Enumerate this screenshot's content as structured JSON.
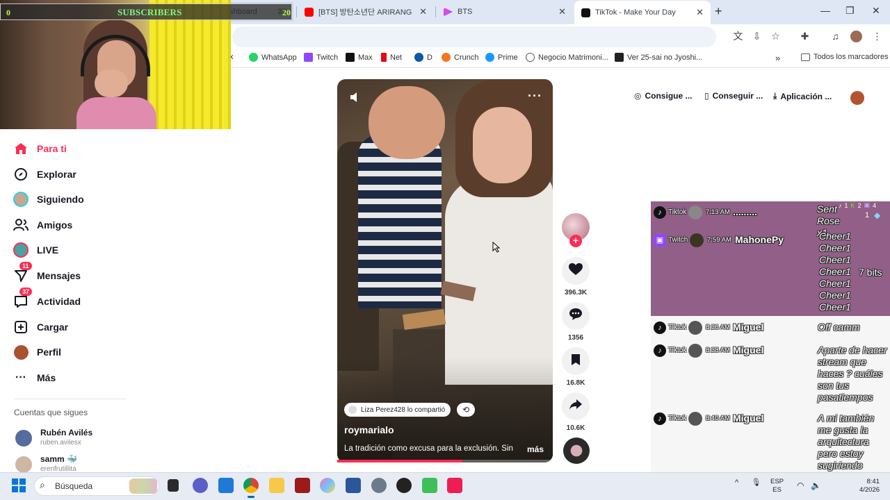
{
  "browser": {
    "tabs": [
      {
        "title": "shboard",
        "counter": "20"
      },
      {
        "title": "[BTS] 방탄소년단 ARIRANG [아",
        "color": "#ff0000"
      },
      {
        "title": "BTS",
        "color": "#ff3df0"
      },
      {
        "title": "TikTok - Make Your Day",
        "active": true
      }
    ],
    "new_tab": "+",
    "window_controls": [
      "minimize-icon",
      "maximize-icon",
      "close-icon"
    ],
    "bookmarks": [
      {
        "label": "x"
      },
      {
        "label": "WhatsApp",
        "color": "#25d366"
      },
      {
        "label": "Twitch",
        "color": "#9146ff"
      },
      {
        "label": "Max",
        "color": "#111111"
      },
      {
        "label": "Net",
        "color": "#e50914"
      },
      {
        "label": "D",
        "color": "#0a58a6"
      },
      {
        "label": "Crunch",
        "color": "#f47521"
      },
      {
        "label": "Prime",
        "color": "#1a98ff"
      },
      {
        "label": "Negocio Matrimoni...",
        "color": "#555555"
      },
      {
        "label": "Ver 25-sai no Jyoshi...",
        "color": "#222222"
      }
    ],
    "bookmarks_overflow": "»",
    "all_bookmarks": "Todos los marcadores"
  },
  "overlay": {
    "subscribers_label": "SUBSCRIBERS",
    "sub_left": "0",
    "sub_right": "20"
  },
  "sidebar": {
    "nav": [
      {
        "label": "Para ti",
        "icon": "home-icon",
        "active": true
      },
      {
        "label": "Explorar",
        "icon": "compass-icon"
      },
      {
        "label": "Siguiendo",
        "icon": "following-avatar-icon"
      },
      {
        "label": "Amigos",
        "icon": "friends-icon"
      },
      {
        "label": "LIVE",
        "icon": "live-icon"
      },
      {
        "label": "Mensajes",
        "icon": "messages-icon",
        "badge": "11"
      },
      {
        "label": "Actividad",
        "icon": "activity-icon",
        "badge": "37"
      },
      {
        "label": "Cargar",
        "icon": "upload-icon"
      },
      {
        "label": "Perfil",
        "icon": "profile-avatar-icon"
      },
      {
        "label": "Más",
        "icon": "more-dots-icon"
      }
    ],
    "following_title": "Cuentas que sigues",
    "accounts": [
      {
        "name": "Rubén Avilés",
        "handle": "ruben.avilesx"
      },
      {
        "name": "samm 🐳",
        "handle": "erenfrutillita"
      }
    ]
  },
  "header": {
    "buttons": [
      "Consigue ...",
      "Conseguir ...",
      "Aplicación ..."
    ]
  },
  "video": {
    "reposted_by": "Liza Perez428 lo compartió",
    "author": "roymarialo",
    "description": "La tradición como excusa para la exclusión. Sin",
    "more": "más",
    "progress": 0.58,
    "likes": "396.3K",
    "comments": "1356",
    "saves": "16.8K",
    "shares": "10.6K"
  },
  "chat": {
    "stats": {
      "tiktok": "1",
      "kick": "2",
      "twitch": "4",
      "viewers": "1"
    },
    "messages": [
      {
        "platform": "Tiktok",
        "time": "7:13 AM",
        "user": ".........",
        "text": "Sent Rose x1"
      },
      {
        "platform": "Twitch",
        "time": "7:59 AM",
        "user": "MahonePy",
        "text": "Cheer1 Cheer1 Cheer1 Cheer1 Cheer1 Cheer1 Cheer1",
        "bits": "7 bits"
      },
      {
        "platform": "Tiktok",
        "time": "8:36 AM",
        "user": "Miguel",
        "text": "Off camm"
      },
      {
        "platform": "Tiktok",
        "time": "8:38 AM",
        "user": "Miguel",
        "text": "Aparte de hacer stream que haces ? cuáles son tus pasatiempos"
      },
      {
        "platform": "Tiktok",
        "time": "8:40 AM",
        "user": "Miguel",
        "text": "A mi también me gusta la arquitectura pero estoy sugiriendo ingeniería química"
      }
    ]
  },
  "taskbar": {
    "search_placeholder": "Búsqueda",
    "lang_line1": "ESP",
    "lang_line2": "ES",
    "time": "8:41",
    "date": "4/2026"
  }
}
